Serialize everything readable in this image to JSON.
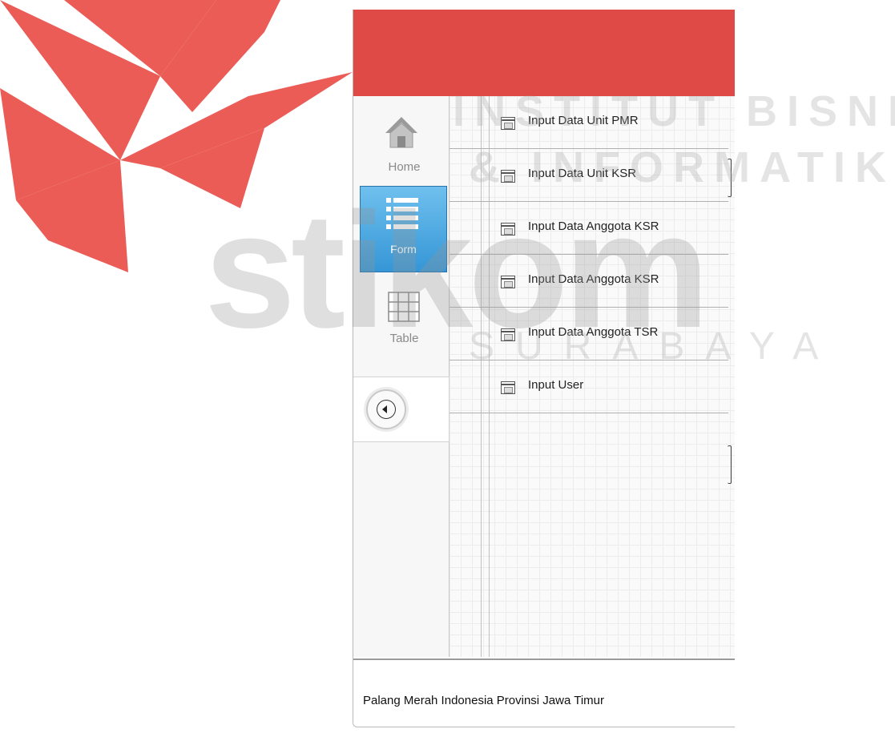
{
  "watermark": {
    "line1": "INSTITUT BISNIS",
    "line2": "& INFORMATIKA",
    "brand": "stikom",
    "city": "SURABAYA"
  },
  "header": {
    "color": "#e04a46"
  },
  "sidebar": {
    "items": [
      {
        "label": "Home",
        "icon": "home-icon",
        "selected": false
      },
      {
        "label": "Form",
        "icon": "list-icon",
        "selected": true
      },
      {
        "label": "Table",
        "icon": "table-icon",
        "selected": false
      }
    ],
    "back_icon": "back-arrow-icon"
  },
  "list": {
    "items": [
      {
        "label": "Input Data Unit PMR",
        "icon": "form-icon"
      },
      {
        "label": "Input Data Unit KSR",
        "icon": "form-icon"
      },
      {
        "label": "Input Data Anggota KSR",
        "icon": "form-icon"
      },
      {
        "label": "Input Data Anggota KSR",
        "icon": "form-icon"
      },
      {
        "label": "Input Data Anggota TSR",
        "icon": "form-icon"
      },
      {
        "label": "Input User",
        "icon": "form-icon"
      }
    ]
  },
  "footer": {
    "text": "Palang Merah Indonesia Provinsi Jawa Timur"
  },
  "colors": {
    "accent_red": "#e04a46",
    "selected_blue": "#3596d6"
  }
}
